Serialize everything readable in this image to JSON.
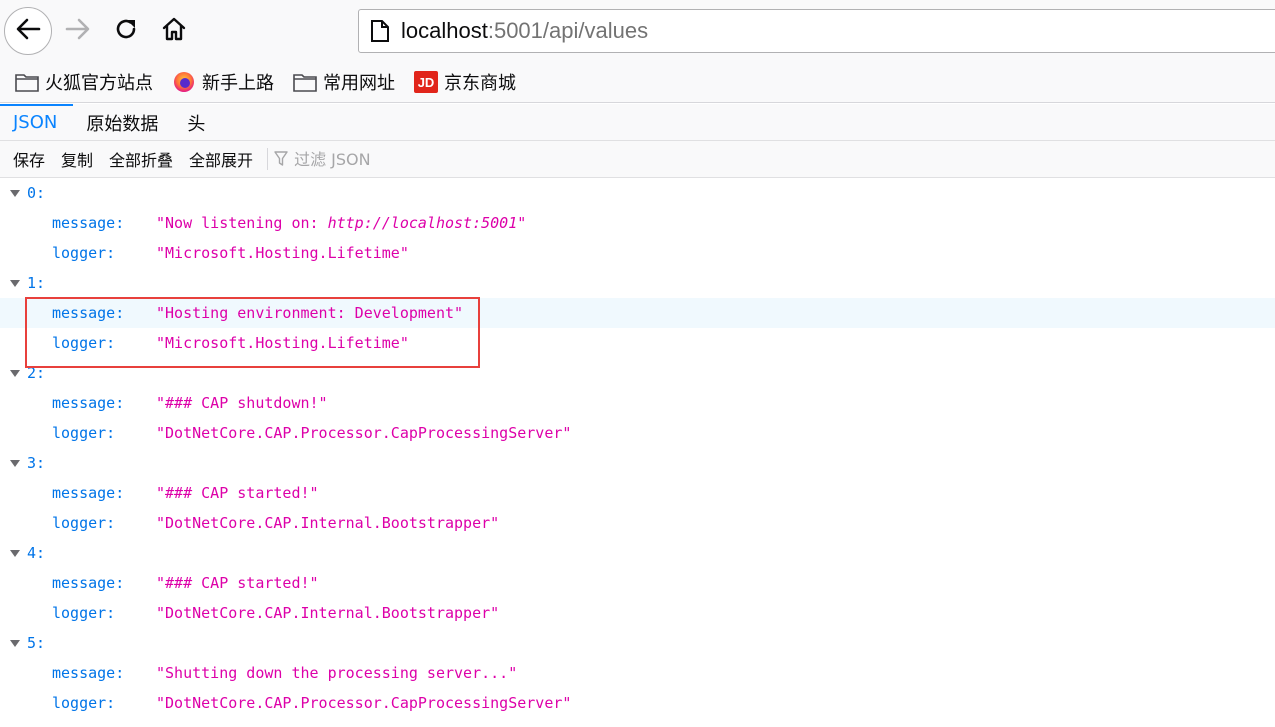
{
  "navbar": {
    "url_host": "localhost",
    "url_rest": ":5001/api/values"
  },
  "bookmarks": [
    {
      "label": "火狐官方站点",
      "icon": "folder-icon"
    },
    {
      "label": "新手上路",
      "icon": "firefox-icon"
    },
    {
      "label": "常用网址",
      "icon": "folder-icon"
    },
    {
      "label": "京东商城",
      "icon": "jd-icon",
      "icon_text": "JD"
    }
  ],
  "tabs": [
    {
      "label": "JSON",
      "selected": true
    },
    {
      "label": "原始数据",
      "selected": false
    },
    {
      "label": "头",
      "selected": false
    }
  ],
  "toolbar": {
    "save": "保存",
    "copy": "复制",
    "collapse_all": "全部折叠",
    "expand_all": "全部展开",
    "filter_placeholder": "过滤 JSON"
  },
  "json": [
    {
      "index": "0:",
      "message_key": "message:",
      "message": "\"Now listening on: ",
      "message_url": "http://localhost:5001",
      "message_end": "\"",
      "logger_key": "logger:",
      "logger": "\"Microsoft.Hosting.Lifetime\""
    },
    {
      "index": "1:",
      "message_key": "message:",
      "message": "\"Hosting environment: Development\"",
      "logger_key": "logger:",
      "logger": "\"Microsoft.Hosting.Lifetime\""
    },
    {
      "index": "2:",
      "message_key": "message:",
      "message": "\"### CAP shutdown!\"",
      "logger_key": "logger:",
      "logger": "\"DotNetCore.CAP.Processor.CapProcessingServer\""
    },
    {
      "index": "3:",
      "message_key": "message:",
      "message": "\"### CAP started!\"",
      "logger_key": "logger:",
      "logger": "\"DotNetCore.CAP.Internal.Bootstrapper\""
    },
    {
      "index": "4:",
      "message_key": "message:",
      "message": "\"### CAP started!\"",
      "logger_key": "logger:",
      "logger": "\"DotNetCore.CAP.Internal.Bootstrapper\""
    },
    {
      "index": "5:",
      "message_key": "message:",
      "message": "\"Shutting down the processing server...\"",
      "logger_key": "logger:",
      "logger": "\"DotNetCore.CAP.Processor.CapProcessingServer\""
    }
  ],
  "colors": {
    "key": "#0074e8",
    "string": "#dd00a9",
    "accent": "#0a84ff",
    "annotation": "#e8403c"
  }
}
